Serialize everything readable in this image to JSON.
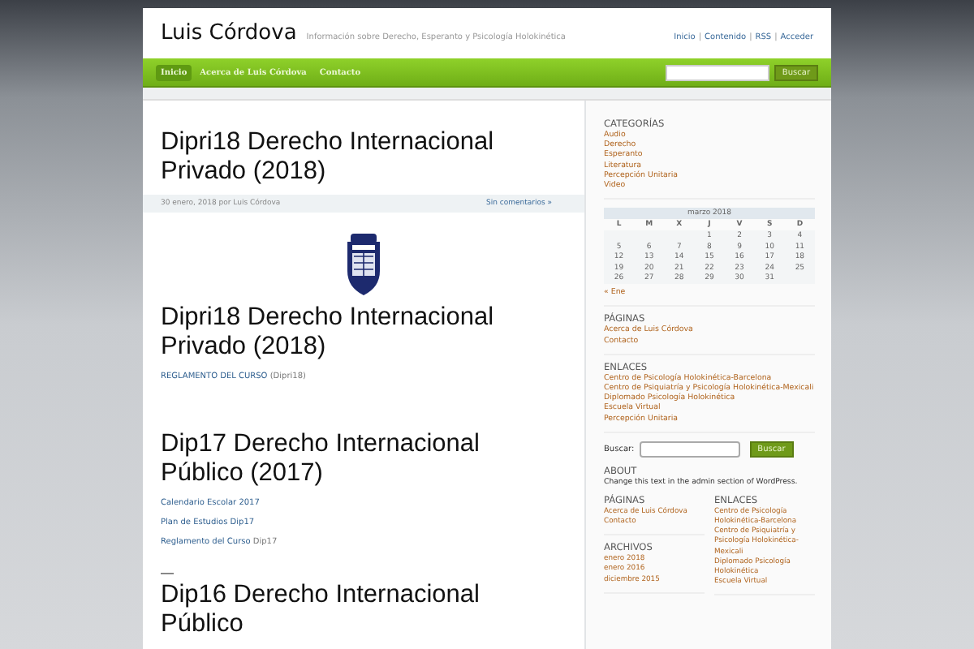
{
  "header": {
    "site_title": "Luis Córdova",
    "tagline": "Información sobre Derecho, Esperanto y Psicología Holokinética",
    "top_links": [
      "Inicio",
      "Contenido",
      "RSS",
      "Acceder"
    ],
    "separator": "|"
  },
  "nav": {
    "items": [
      {
        "label": "Inicio",
        "selected": true
      },
      {
        "label": "Acerca de Luis Córdova",
        "selected": false
      },
      {
        "label": "Contacto",
        "selected": false
      }
    ],
    "search_button": "Buscar"
  },
  "post": {
    "title": "Dipri18 Derecho Internacional Privado (2018)",
    "meta": {
      "byline": "30 enero, 2018 por Luis Córdova",
      "comments": "Sin comentarios »"
    },
    "blocks": [
      {
        "kind": "logo"
      },
      {
        "kind": "heading",
        "text": "Dipri18 Derecho Internacional Privado (2018)"
      },
      {
        "kind": "linkline",
        "link": "REGLAMENTO DEL CURSO",
        "suffix": "(Dipri18)"
      },
      {
        "kind": "heading",
        "text": "Dip17 Derecho Internacional Público (2017)"
      },
      {
        "kind": "link",
        "text": "Calendario Escolar 2017"
      },
      {
        "kind": "link",
        "text": "Plan de Estudios Dip17"
      },
      {
        "kind": "linkline",
        "link": "Reglamento del Curso",
        "suffix": "Dip17"
      },
      {
        "kind": "rule"
      },
      {
        "kind": "heading",
        "text": "Dip16 Derecho Internacional Público"
      }
    ]
  },
  "sidebar": {
    "categories": {
      "title": "CATEGORÍAS",
      "items": [
        "Audio",
        "Derecho",
        "Esperanto",
        "Literatura",
        "Percepción Unitaria",
        "Video"
      ]
    },
    "calendar": {
      "caption": "marzo 2018",
      "weekdays": [
        "L",
        "M",
        "X",
        "J",
        "V",
        "S",
        "D"
      ],
      "weeks": [
        [
          {
            "kind": "blank"
          },
          {
            "kind": "blank"
          },
          {
            "kind": "blank"
          },
          {
            "kind": "day",
            "day": "1"
          },
          {
            "kind": "day",
            "day": "2"
          },
          {
            "kind": "day",
            "day": "3"
          },
          {
            "kind": "day",
            "day": "4"
          }
        ],
        [
          {
            "kind": "day",
            "day": "5"
          },
          {
            "kind": "day",
            "day": "6"
          },
          {
            "kind": "day",
            "day": "7"
          },
          {
            "kind": "day",
            "day": "8"
          },
          {
            "kind": "day",
            "day": "9"
          },
          {
            "kind": "day",
            "day": "10"
          },
          {
            "kind": "day",
            "day": "11"
          }
        ],
        [
          {
            "kind": "day",
            "day": "12"
          },
          {
            "kind": "day",
            "day": "13"
          },
          {
            "kind": "day",
            "day": "14"
          },
          {
            "kind": "day",
            "day": "15"
          },
          {
            "kind": "day",
            "day": "16"
          },
          {
            "kind": "day",
            "day": "17"
          },
          {
            "kind": "day",
            "day": "18"
          }
        ],
        [
          {
            "kind": "day",
            "day": "19"
          },
          {
            "kind": "day",
            "day": "20"
          },
          {
            "kind": "day",
            "day": "21"
          },
          {
            "kind": "day",
            "day": "22"
          },
          {
            "kind": "day",
            "day": "23"
          },
          {
            "kind": "day",
            "day": "24"
          },
          {
            "kind": "day",
            "day": "25"
          }
        ],
        [
          {
            "kind": "day",
            "day": "26"
          },
          {
            "kind": "day",
            "day": "27"
          },
          {
            "kind": "day",
            "day": "28"
          },
          {
            "kind": "day",
            "day": "29"
          },
          {
            "kind": "day",
            "day": "30"
          },
          {
            "kind": "day",
            "day": "31"
          },
          {
            "kind": "blank"
          }
        ]
      ],
      "prev_link": "« Ene"
    },
    "pages": {
      "title": "PÁGINAS",
      "items": [
        "Acerca de Luis Córdova",
        "Contacto"
      ]
    },
    "links": {
      "title": "ENLACES",
      "items": [
        "Centro de Psicología Holokinética-Barcelona",
        "Centro de Psiquiatría y Psicología Holokinética-Mexicali",
        "Diplomado Psicología Holokinética",
        "Escuela Virtual",
        "Percepción Unitaria"
      ]
    },
    "search": {
      "label": "Buscar:",
      "button": "Buscar"
    },
    "about": {
      "title": "ABOUT",
      "text": "Change this text in the admin section of WordPress."
    },
    "left_column": [
      {
        "title": "PÁGINAS",
        "items": [
          "Acerca de Luis Córdova",
          "Contacto"
        ]
      },
      {
        "title": "ARCHIVOS",
        "items": [
          "enero 2018",
          "enero 2016",
          "diciembre 2015"
        ]
      }
    ],
    "right_column": [
      {
        "title": "ENLACES",
        "items": [
          "Centro de Psicología Holokinética-Barcelona",
          "Centro de Psiquiatría y Psicología Holokinética-Mexicali",
          "Diplomado Psicología Holokinética",
          "Escuela Virtual"
        ]
      }
    ]
  }
}
